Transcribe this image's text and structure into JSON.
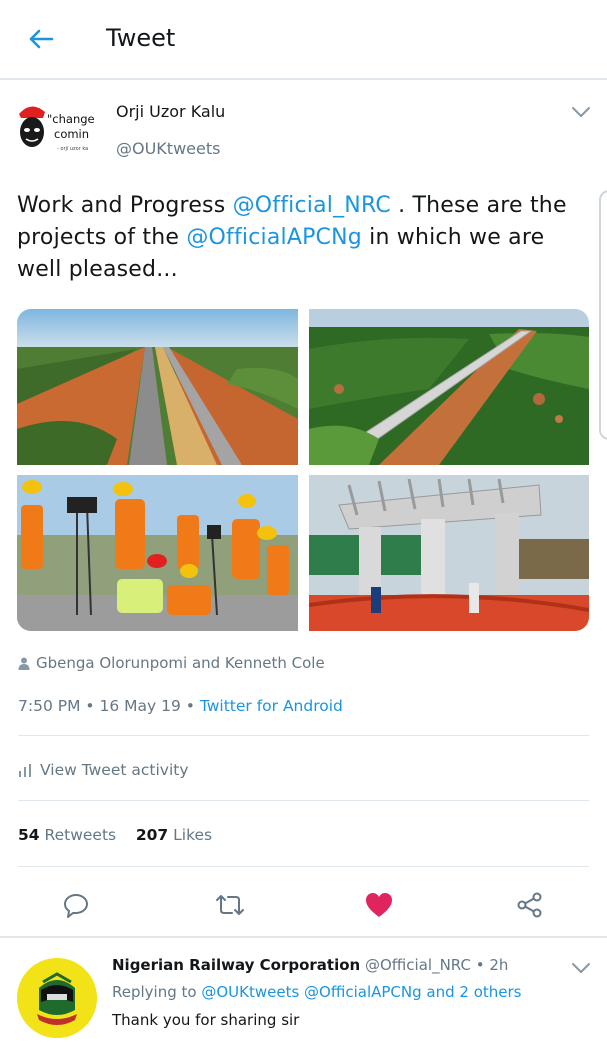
{
  "header": {
    "title": "Tweet",
    "back_icon": "arrow-left-icon"
  },
  "tweet": {
    "author": {
      "name": "Orji Uzor Kalu",
      "handle": "@OUKtweets",
      "avatar_text": [
        "\"change",
        "comin",
        "- orji uzor ka"
      ]
    },
    "text_parts": {
      "p1": "Work and Progress ",
      "m1": "@Official_NRC",
      "p2": " . These are the projects of the ",
      "m2": "@OfficialAPCNg",
      "p3": " in which we are well pleased..."
    },
    "media": [
      {
        "name": "railway-track-aerial",
        "description": "Aerial view of railway track construction"
      },
      {
        "name": "railway-viaduct-aerial",
        "description": "Aerial view of elevated railway viaduct"
      },
      {
        "name": "workers-survey",
        "description": "Construction workers in hard hats at survey instruments"
      },
      {
        "name": "bridge-pillars",
        "description": "Concrete bridge pillars under construction"
      }
    ],
    "liked_by": "Gbenga Olorunpomi and Kenneth Cole",
    "time": "7:50 PM",
    "date": "16 May 19",
    "client": "Twitter for Android",
    "separator": " • ",
    "activity_label": "View Tweet activity",
    "retweets_count": "54",
    "retweets_label": "Retweets",
    "likes_count": "207",
    "likes_label": "Likes",
    "actions": [
      "reply-icon",
      "retweet-icon",
      "heart-icon",
      "share-icon"
    ]
  },
  "reply": {
    "name": "Nigerian Railway Corporation",
    "handle": "@Official_NRC",
    "age": "2h",
    "dot": " • ",
    "replying_prefix": "Replying to ",
    "replying_mentions": "@OUKtweets @OfficialAPCNg",
    "replying_suffix": " and 2 others",
    "text": "Thank you for sharing sir"
  },
  "colors": {
    "accent": "#1b95e0",
    "like": "#e0245e",
    "muted": "#657786",
    "text": "#14171a",
    "divider": "#e1e8ed"
  }
}
